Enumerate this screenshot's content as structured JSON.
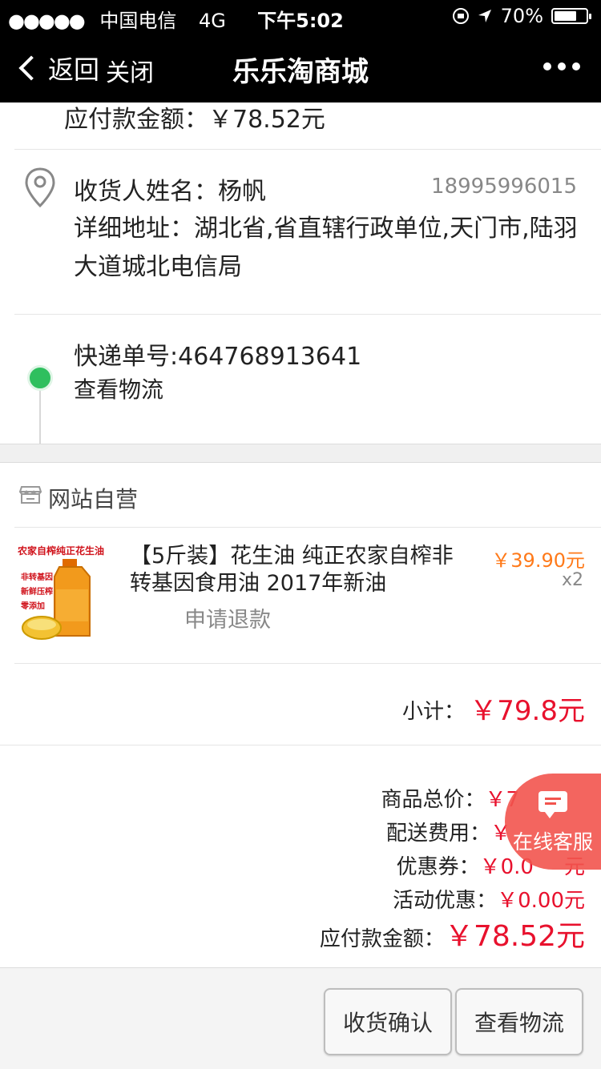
{
  "status_bar": {
    "signal": "●●●●●",
    "carrier": "中国电信",
    "network": "4G",
    "time": "下午5:02",
    "battery": "70%",
    "battery_level": 0.7
  },
  "nav": {
    "back_label": "返回",
    "close_label": "关闭",
    "title": "乐乐淘商城"
  },
  "order": {
    "top_amount": "应付款金额：￥78.52元",
    "recipient": "收货人姓名：杨帆",
    "phone": "18995996015",
    "address": "详细地址：湖北省,省直辖行政单位,天门市,陆羽大道城北电信局",
    "tracking": "快递单号:464768913641",
    "view_logistics": "查看物流"
  },
  "shop": {
    "name": "网站自营"
  },
  "product": {
    "image_text": {
      "line1": "农家自榨纯正花生油",
      "line2": "非转基因",
      "line3": "新鲜压榨",
      "line4": "零添加"
    },
    "title": "【5斤装】花生油 纯正农家自榨非转基因食用油 2017年新油",
    "price": "￥39.90元",
    "qty": "x2",
    "refund": "申请退款"
  },
  "subtotal": {
    "label": "小计：",
    "value": "￥79.8元"
  },
  "summary": {
    "goods_label": "商品总价：",
    "goods_value": "￥7",
    "shipping_label": "配送费用：",
    "shipping_value": "￥",
    "coupon_label": "优惠券：",
    "coupon_value": "￥0.0",
    "coupon_tail": "元",
    "promo_label": "活动优惠：",
    "promo_value": "￥0.00元",
    "payable_label": "应付款金额：",
    "payable_value": "￥78.52元"
  },
  "buttons": {
    "confirm": "收货确认",
    "logistics": "查看物流"
  },
  "chat": {
    "label": "在线客服"
  },
  "colors": {
    "accent_red": "#e8112d",
    "price_orange": "#ff7a1a",
    "status_green": "#2fbf5e",
    "chat_red": "#f2544e"
  }
}
